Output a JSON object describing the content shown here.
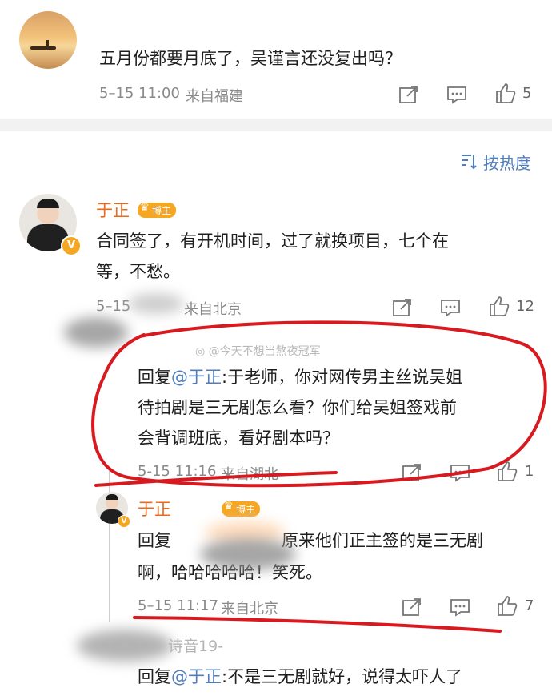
{
  "top_comment": {
    "text": "五月份都要月底了，吴谨言还没复出吗？",
    "time": "5–15 11:00",
    "location": "来自福建",
    "likes": "5"
  },
  "sort": {
    "label": "按热度"
  },
  "main_comment": {
    "author": "于正",
    "badge": "博主",
    "text_line1": "合同签了，有开机时间，过了就换项目，七个在",
    "text_line2": "等，不愁。",
    "time_partial": "5–15",
    "location_partial": "来自北京",
    "likes": "12"
  },
  "watermark": "@今天不想当熬夜冠军",
  "reply1": {
    "prefix": "回复",
    "mention": "@于正",
    "line1_rest": ":于老师，你对网传男主丝说吴姐",
    "line2": "待拍剧是三无剧怎么看？你们给吴姐签戏前",
    "line3": "会背调班底，看好剧本吗？",
    "time": "5-15 11:16",
    "location": "来自湖北",
    "likes": "1"
  },
  "reply2": {
    "author": "于正",
    "badge": "博主",
    "prefix": "回复",
    "line1_rest": "原来他们正主签的是三无剧",
    "line2": "啊，哈哈哈哈哈！笑死。",
    "time": "5–15 11:17",
    "location": "来自北京",
    "likes": "7"
  },
  "reply3": {
    "author_partial": "诗音19-",
    "prefix": "回复",
    "mention": "@于正",
    "text": ":不是三无剧就好，说得太吓人了"
  },
  "colors": {
    "annotation_red": "#d8191f",
    "author_orange": "#e86a1a",
    "mention_blue": "#4f7dbd",
    "badge_gold": "#f5a623"
  }
}
